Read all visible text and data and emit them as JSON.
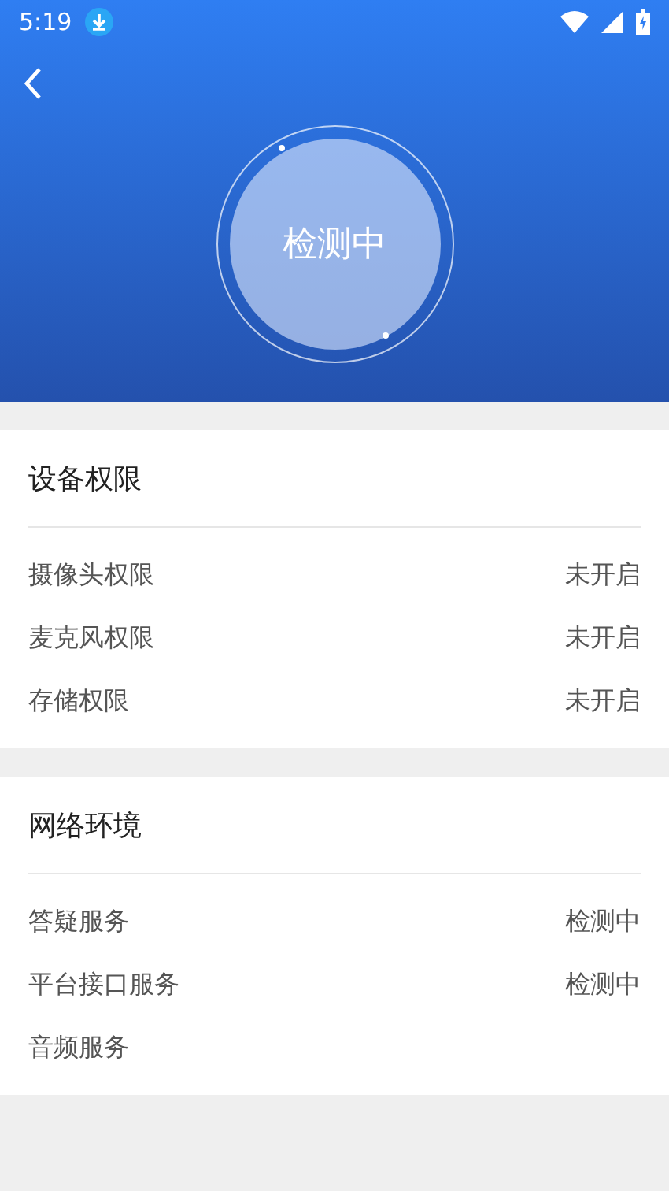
{
  "status_bar": {
    "time": "5:19"
  },
  "header": {
    "status_text": "检测中"
  },
  "sections": [
    {
      "title": "设备权限",
      "items": [
        {
          "label": "摄像头权限",
          "status": "未开启"
        },
        {
          "label": "麦克风权限",
          "status": "未开启"
        },
        {
          "label": "存储权限",
          "status": "未开启"
        }
      ]
    },
    {
      "title": "网络环境",
      "items": [
        {
          "label": "答疑服务",
          "status": "检测中"
        },
        {
          "label": "平台接口服务",
          "status": "检测中"
        },
        {
          "label": "音频服务"
        }
      ]
    }
  ]
}
